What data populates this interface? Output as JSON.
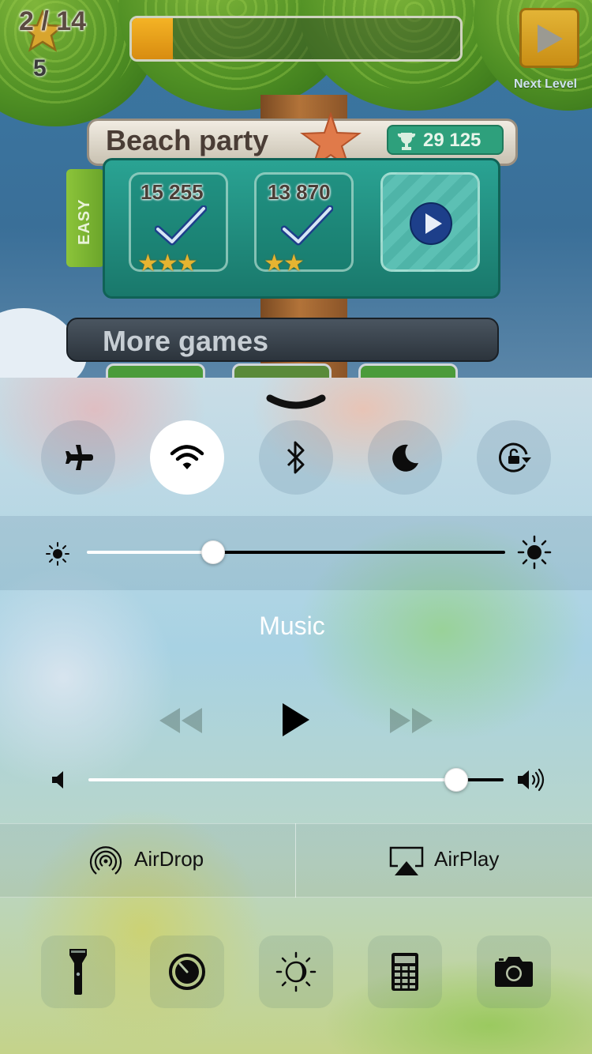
{
  "game": {
    "stars": "5",
    "progress_text": "2 / 14",
    "progress_fraction": 0.125,
    "next_level_label": "Next Level",
    "level_title": "Beach party",
    "trophy_score": "29 125",
    "difficulty": "EASY",
    "levels": [
      {
        "score": "15 255",
        "stars": "★★★",
        "state": "completed"
      },
      {
        "score": "13 870",
        "stars": "★★",
        "state": "completed"
      },
      {
        "score": "",
        "stars": "",
        "state": "play"
      }
    ],
    "more_games_label": "More games"
  },
  "control_center": {
    "toggles": [
      {
        "name": "airplane-mode",
        "icon": "airplane-icon",
        "on": false
      },
      {
        "name": "wifi",
        "icon": "wifi-icon",
        "on": true
      },
      {
        "name": "bluetooth",
        "icon": "bluetooth-icon",
        "on": false
      },
      {
        "name": "do-not-disturb",
        "icon": "moon-icon",
        "on": false
      },
      {
        "name": "rotation-lock",
        "icon": "rotation-lock-icon",
        "on": false
      }
    ],
    "brightness_level": 0.29,
    "music": {
      "title": "Music",
      "volume_level": 0.91
    },
    "airdrop_label": "AirDrop",
    "airplay_label": "AirPlay",
    "shortcuts": [
      {
        "name": "flashlight",
        "icon": "flashlight-icon"
      },
      {
        "name": "timer",
        "icon": "timer-icon"
      },
      {
        "name": "night-shift",
        "icon": "night-shift-icon"
      },
      {
        "name": "calculator",
        "icon": "calculator-icon"
      },
      {
        "name": "camera",
        "icon": "camera-icon"
      }
    ],
    "colors": {
      "toggle_on": "#ffffff",
      "slider_min": "#ffffff",
      "slider_max": "#000000"
    }
  }
}
